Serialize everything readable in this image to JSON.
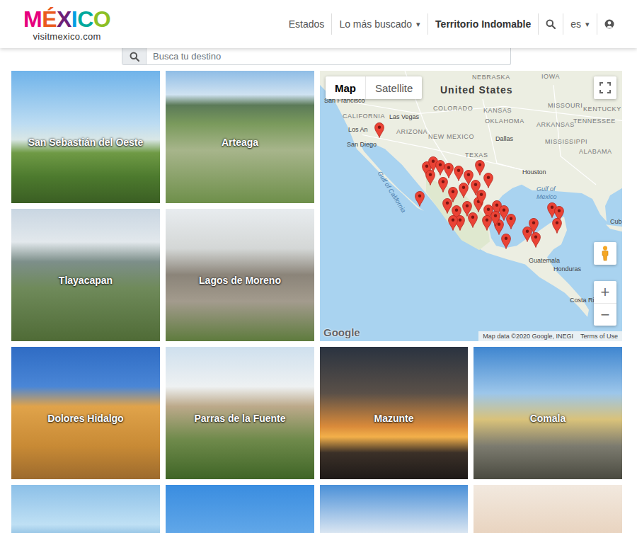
{
  "header": {
    "logo": {
      "letters": [
        {
          "char": "M",
          "color": "#e6007e"
        },
        {
          "char": "É",
          "color": "#ea5a1e"
        },
        {
          "char": "X",
          "color": "#6d2077"
        },
        {
          "char": "I",
          "color": "#009fe3"
        },
        {
          "char": "C",
          "color": "#00a99d"
        },
        {
          "char": "O",
          "color": "#8cbf26"
        }
      ],
      "domain": "visitmexico.com"
    },
    "nav": [
      {
        "label": "Estados",
        "kind": "link"
      },
      {
        "label": "Lo más buscado",
        "caret": "▾",
        "kind": "dropdown"
      },
      {
        "label": "Territorio Indomable",
        "kind": "featured"
      },
      {
        "kind": "search"
      },
      {
        "label": "es",
        "caret": "▾",
        "kind": "dropdown"
      },
      {
        "kind": "account"
      }
    ]
  },
  "search": {
    "placeholder": "Busca tu destino"
  },
  "tiles": [
    {
      "label": "San Sebastián del Oeste"
    },
    {
      "label": "Arteaga"
    },
    {
      "label": "Tlayacapan"
    },
    {
      "label": "Lagos de Moreno"
    },
    {
      "label": "Dolores Hidalgo"
    },
    {
      "label": "Parras de la Fuente"
    },
    {
      "label": "Mazunte"
    },
    {
      "label": "Comala"
    },
    {},
    {},
    {},
    {}
  ],
  "map": {
    "types": [
      {
        "label": "Map",
        "selected": true
      },
      {
        "label": "Satellite",
        "selected": false
      }
    ],
    "labels": [
      "United States",
      "NEBRASKA",
      "IOWA",
      "COLORADO",
      "KANSAS",
      "MISSOURI",
      "KENTUCKY",
      "San Francisco",
      "CALIFORNIA",
      "Las Vegas",
      "Los An",
      "San Diego",
      "ARIZONA",
      "NEW MEXICO",
      "OKLAHOMA",
      "ARKANSAS",
      "TENNESSEE",
      "MISSISSIPPI",
      "ALABAMA",
      "Dallas",
      "TEXAS",
      "Houston",
      "Gulf of",
      "Mexico",
      "Gulf of California",
      "Guatemala",
      "Honduras",
      "Costa Ri",
      "Cub"
    ],
    "marker_count": 37,
    "zoom": [
      "+",
      "−"
    ],
    "logo": "Google",
    "attribution": "Map data ©2020 Google, INEGI",
    "terms": "Terms of Use"
  }
}
